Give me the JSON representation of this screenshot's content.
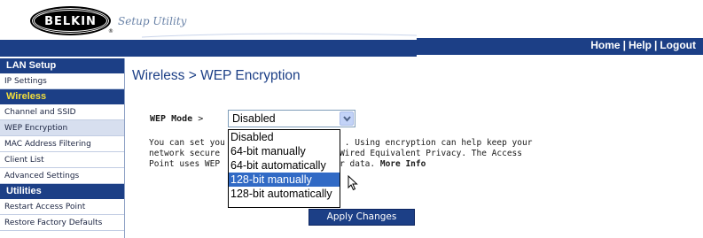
{
  "header": {
    "logo_text": "BELKIN",
    "logo_mark": "®",
    "product_title": "Setup Utility",
    "links": [
      "Home",
      "Help",
      "Logout"
    ],
    "link_separator": "|",
    "brand_color": "#1c3f86"
  },
  "sidebar": {
    "sections": [
      {
        "heading": "LAN Setup",
        "active": false,
        "items": [
          "IP Settings"
        ]
      },
      {
        "heading": "Wireless",
        "active": true,
        "items": [
          "Channel and SSID",
          "WEP Encryption",
          "MAC Address Filtering",
          "Client List",
          "Advanced Settings"
        ]
      },
      {
        "heading": "Utilities",
        "active": false,
        "items": [
          "Restart Access Point",
          "Restore Factory Defaults"
        ]
      }
    ],
    "selected_item": "WEP Encryption"
  },
  "main": {
    "title": "Wireless > WEP Encryption",
    "wep_mode_label": "WEP Mode",
    "wep_mode_arrow": ">",
    "wep_mode_value": "Disabled",
    "description_lines": [
      "You can set you",
      "network secure",
      "Point uses WEP"
    ],
    "description_tails": [
      ". Using encryption can help keep your",
      "Wired Equivalent Privacy. The Access",
      "r data."
    ],
    "more_info_label": "More Info",
    "dropdown_options": [
      "Disabled",
      "64-bit manually",
      "64-bit automatically",
      "128-bit manually",
      "128-bit automatically"
    ],
    "highlighted_option": "128-bit manually",
    "apply_button_label": "Apply Changes"
  }
}
